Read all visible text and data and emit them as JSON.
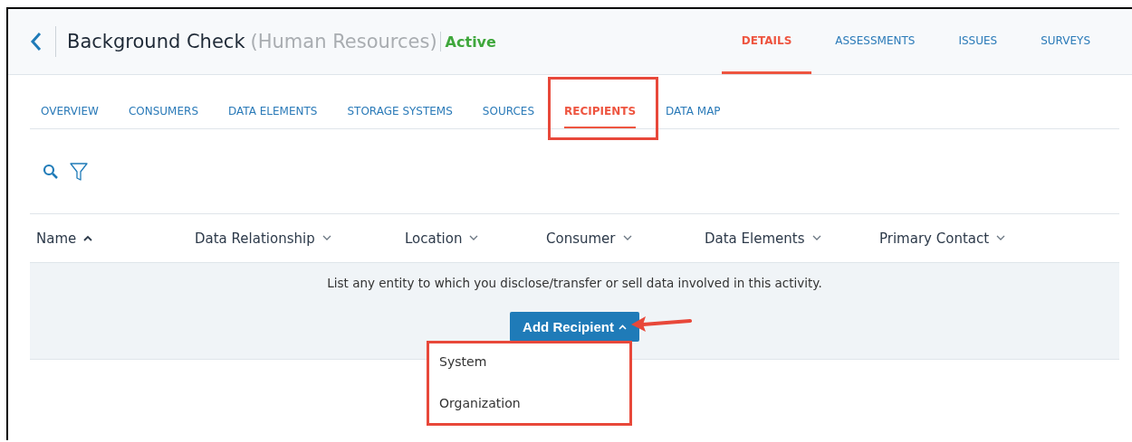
{
  "header": {
    "title": "Background Check",
    "subtitle": "(Human Resources)",
    "status": "Active"
  },
  "main_tabs": [
    {
      "label": "DETAILS",
      "selected": true
    },
    {
      "label": "ASSESSMENTS",
      "selected": false
    },
    {
      "label": "ISSUES",
      "selected": false
    },
    {
      "label": "SURVEYS",
      "selected": false
    }
  ],
  "sub_tabs": [
    {
      "label": "OVERVIEW",
      "selected": false,
      "highlighted": false
    },
    {
      "label": "CONSUMERS",
      "selected": false,
      "highlighted": false
    },
    {
      "label": "DATA ELEMENTS",
      "selected": false,
      "highlighted": false
    },
    {
      "label": "STORAGE SYSTEMS",
      "selected": false,
      "highlighted": false
    },
    {
      "label": "SOURCES",
      "selected": false,
      "highlighted": false
    },
    {
      "label": "RECIPIENTS",
      "selected": true,
      "highlighted": true
    },
    {
      "label": "DATA MAP",
      "selected": false,
      "highlighted": false
    }
  ],
  "table": {
    "columns": [
      {
        "label": "Name",
        "sorted_ascending": true
      },
      {
        "label": "Data Relationship",
        "sorted_ascending": false
      },
      {
        "label": "Location",
        "sorted_ascending": false
      },
      {
        "label": "Consumer",
        "sorted_ascending": false
      },
      {
        "label": "Data Elements",
        "sorted_ascending": false
      },
      {
        "label": "Primary Contact",
        "sorted_ascending": false
      }
    ],
    "empty_message": "List any entity to which you disclose/transfer or sell data involved in this activity."
  },
  "add_button": {
    "label": "Add Recipient",
    "expanded": true,
    "pointed_at": true
  },
  "dropdown": {
    "highlighted": true,
    "items": [
      "System",
      "Organization"
    ]
  }
}
